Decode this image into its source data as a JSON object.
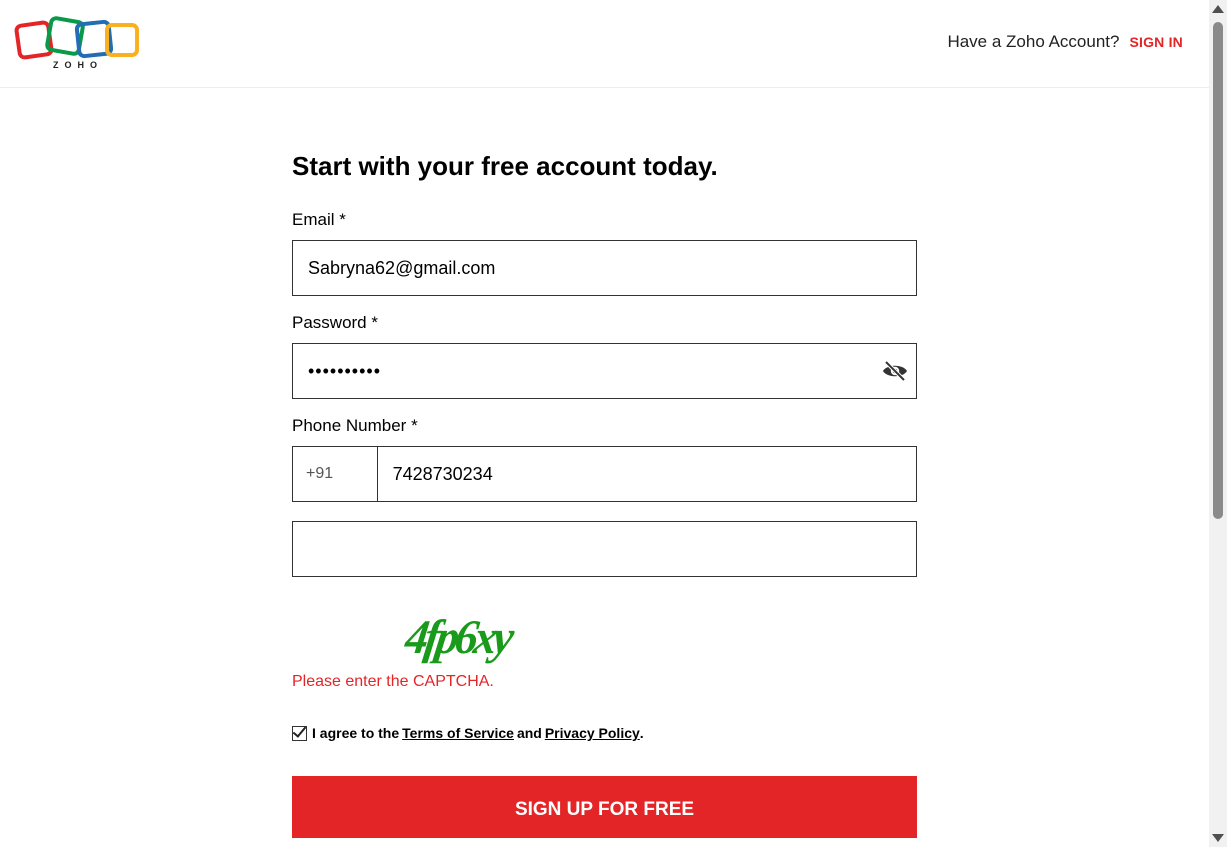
{
  "header": {
    "logo_word": "ZOHO",
    "have_account": "Have a Zoho Account?",
    "sign_in": "SIGN IN"
  },
  "form": {
    "title": "Start with your free account today.",
    "email": {
      "label": "Email *",
      "value": "Sabryna62@gmail.com"
    },
    "password": {
      "label": "Password *",
      "masked_value": "••••••••••"
    },
    "phone": {
      "label": "Phone Number *",
      "country_code": "+91",
      "value": "7428730234"
    },
    "captcha": {
      "value": "",
      "image_text": "4fp6xy",
      "error": "Please enter the CAPTCHA."
    },
    "agree": {
      "prefix": "I agree to the",
      "terms": "Terms of Service",
      "and": "and",
      "privacy": "Privacy Policy",
      "suffix": "."
    },
    "signup_button": "SIGN UP FOR FREE"
  },
  "colors": {
    "accent": "#e42527",
    "captcha_green": "#1a9a1a"
  },
  "icons": {
    "password_toggle": "eye-slash-icon",
    "checkbox": "checkmark-icon"
  }
}
